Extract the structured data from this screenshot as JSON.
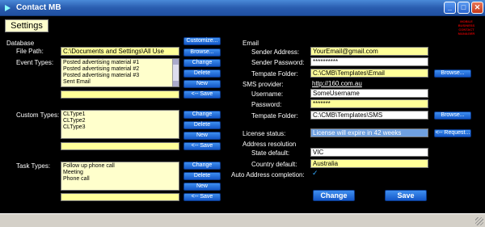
{
  "window": {
    "title": "Contact MB"
  },
  "header": {
    "settings_label": "Settings",
    "logo_text": "MOBILE BUSINESS CONTACT MANAGER"
  },
  "database": {
    "section_label": "Database",
    "file_path_label": "File Path:",
    "file_path_value": "C:\\Documents and Settings\\All Use",
    "customize_button": "Customize...",
    "browse_button": "Browse...",
    "event_types_label": "Event Types:",
    "event_types": [
      "Posted advertising material #1",
      "Posted advertising material #2",
      "Posted advertising material #3",
      "Sent Email"
    ],
    "custom_types_label": "Custom Types:",
    "custom_types": [
      "CLType1",
      "CLType2",
      "CLType3"
    ],
    "task_types_label": "Task Types:",
    "task_types": [
      "Follow up phone call",
      "Meeting",
      "Phone call"
    ],
    "change_button": "Change",
    "delete_button": "Delete",
    "new_button": "New",
    "save_button": "<-- Save"
  },
  "email": {
    "section_label": "Email",
    "sender_address_label": "Sender Address:",
    "sender_address_value": "YourEmail@gmail.com",
    "sender_password_label": "Sender Password:",
    "sender_password_value": "**********",
    "template_folder_label": "Tempate Folder:",
    "template_folder_value": "C:\\CMB\\Templates\\Email",
    "browse_button": "Browse..."
  },
  "sms": {
    "provider_label": "SMS provider:",
    "provider_link": "http://160.com.au",
    "username_label": "Username:",
    "username_value": "SomeUsername",
    "password_label": "Password:",
    "password_value": "*******",
    "template_folder_label": "Tempate Folder:",
    "template_folder_value": "C:\\CMB\\Templates\\SMS",
    "browse_button": "Browse..."
  },
  "license": {
    "status_label": "License status:",
    "status_value": "License will expire in 42 weeks",
    "request_button": "<-- Request..."
  },
  "address": {
    "section_label": "Address resolution",
    "state_label": "State default:",
    "state_value": "VIC",
    "country_label": "Country default:",
    "country_value": "Australia",
    "auto_label": "Auto Address completion:",
    "auto_checked": true
  },
  "actions": {
    "change_label": "Change",
    "save_label": "Save"
  }
}
